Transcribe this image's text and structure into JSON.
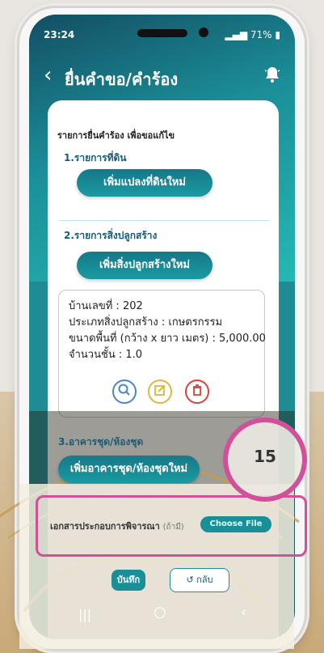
{
  "status": {
    "time": "23:24",
    "battery": "71%"
  },
  "appbar": {
    "title": "ยื่นคำขอ/คำร้อง"
  },
  "card": {
    "heading": "รายการยื่นคำร้อง เพื่อขอแก้ไข",
    "land": {
      "title": "1.รายการที่ดิน",
      "button": "เพิ่มแปลงที่ดินใหม่"
    },
    "structure": {
      "title": "2.รายการสิ่งปลูกสร้าง",
      "button": "เพิ่มสิ่งปลูกสร้างใหม่"
    },
    "record": {
      "lines": [
        "บ้านเลขที่ : 202",
        "ประเภทสิ่งปลูกสร้าง : เกษตรกรรม",
        "ขนาดพื้นที่ (กว้าง x ยาว เมตร) : 5,000.00",
        "จำนวนชั้น : 1.0"
      ]
    },
    "condo": {
      "title": "3.อาคารชุด/ห้องชุด",
      "button": "เพิ่มอาคารชุด/ห้องชุดใหม่"
    },
    "documents": {
      "label": "เอกสารประกอบการพิจารณา",
      "optional": "(ถ้ามี)",
      "file_button": "Choose File"
    },
    "actions": {
      "save": "บันทึก",
      "back": "กลับ",
      "back_icon": "↺"
    }
  },
  "annotation": {
    "step": "15"
  },
  "icons": {
    "search": "search-icon",
    "edit": "edit-icon",
    "delete": "trash-icon",
    "bell": "bell-icon"
  },
  "colors": {
    "primary": "#1a8f98",
    "highlight": "#d0509a"
  }
}
